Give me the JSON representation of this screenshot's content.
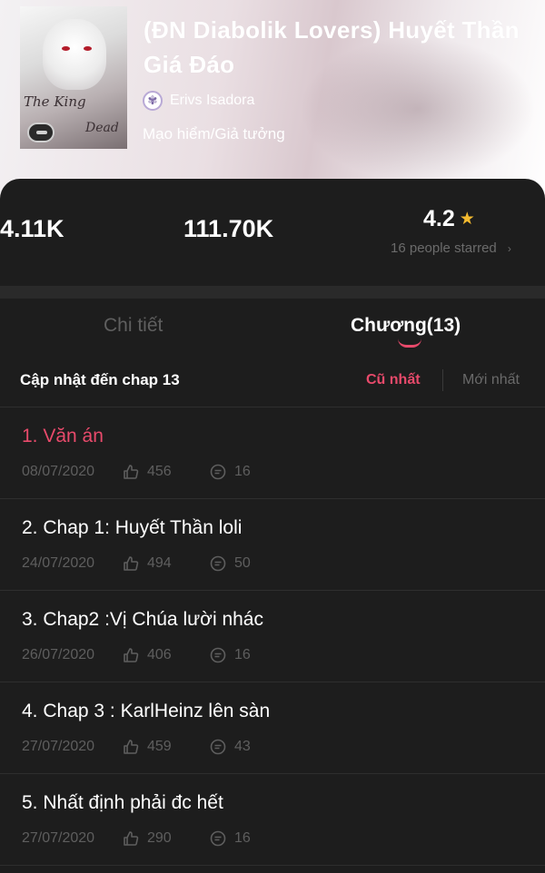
{
  "book": {
    "title": "(ĐN Diabolik Lovers) Huyết Thần Giá Đáo",
    "author": "Erivs Isadora",
    "genre": "Mạo hiểm/Giả tưởng",
    "cover_text_1": "The",
    "cover_text_2": "King",
    "cover_text_3": "Dead"
  },
  "stats": {
    "reads": "4.11K",
    "votes": "111.70K",
    "rating": "4.2",
    "rating_people": "16 people starred"
  },
  "tabs": {
    "detail": "Chi tiết",
    "chapters": "Chương(13)"
  },
  "update": {
    "text": "Cập nhật đến chap 13",
    "oldest": "Cũ nhất",
    "newest": "Mới nhất"
  },
  "chapters": [
    {
      "title": "1. Văn án",
      "date": "08/07/2020",
      "likes": "456",
      "comments": "16"
    },
    {
      "title": "2. Chap 1: Huyết Thần loli",
      "date": "24/07/2020",
      "likes": "494",
      "comments": "50"
    },
    {
      "title": "3. Chap2 :Vị Chúa lười nhác",
      "date": "26/07/2020",
      "likes": "406",
      "comments": "16"
    },
    {
      "title": "4. Chap 3 : KarlHeinz lên sàn",
      "date": "27/07/2020",
      "likes": "459",
      "comments": "43"
    },
    {
      "title": "5. Nhất định phải đc hết",
      "date": "27/07/2020",
      "likes": "290",
      "comments": "16"
    }
  ],
  "colors": {
    "accent": "#e84a6b",
    "star": "#f3ba2f",
    "background": "#1d1d1d"
  },
  "icons": {
    "like": "thumbs-up-icon",
    "comment": "comment-icon",
    "star": "star-icon",
    "chevron": "chevron-right-icon"
  }
}
